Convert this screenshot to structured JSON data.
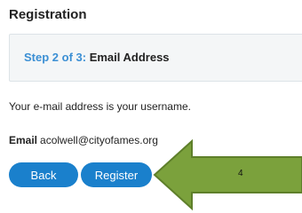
{
  "page": {
    "title": "Registration"
  },
  "step": {
    "prefix": "Step 2 of 3:",
    "name": "Email Address"
  },
  "info_text": "Your e-mail address is your username.",
  "email": {
    "label": "Email",
    "value": "acolwell@cityofames.org"
  },
  "buttons": {
    "back_label": "Back",
    "register_label": "Register"
  },
  "callout": {
    "number": "4",
    "fill_color": "#7ba13c",
    "stroke_color": "#5e7f2a"
  },
  "colors": {
    "accent": "#1a80cc",
    "step_prefix": "#3b8fd4"
  }
}
